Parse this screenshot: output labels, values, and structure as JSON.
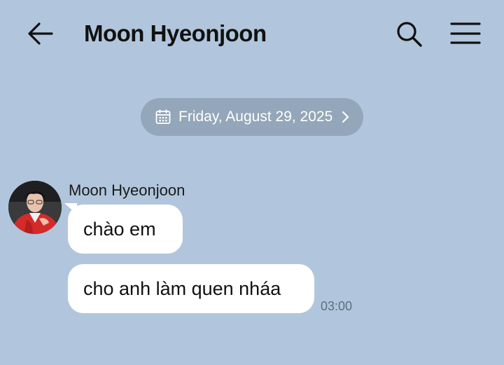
{
  "header": {
    "title": "Moon Hyeonjoon",
    "back_icon": "arrow-left-icon",
    "search_icon": "search-icon",
    "menu_icon": "hamburger-menu-icon"
  },
  "date_divider": {
    "label": "Friday, August 29, 2025",
    "icon": "calendar-icon",
    "chevron": "chevron-right-icon"
  },
  "messages": [
    {
      "sender": "Moon Hyeonjoon",
      "bubbles": [
        {
          "text": "chào em"
        },
        {
          "text": "cho anh làm quen nháa",
          "time": "03:00"
        }
      ]
    }
  ],
  "colors": {
    "background": "#b1c6dc",
    "date_pill": "#94a6b9",
    "bubble": "#ffffff",
    "timestamp": "#5f6e7c"
  }
}
